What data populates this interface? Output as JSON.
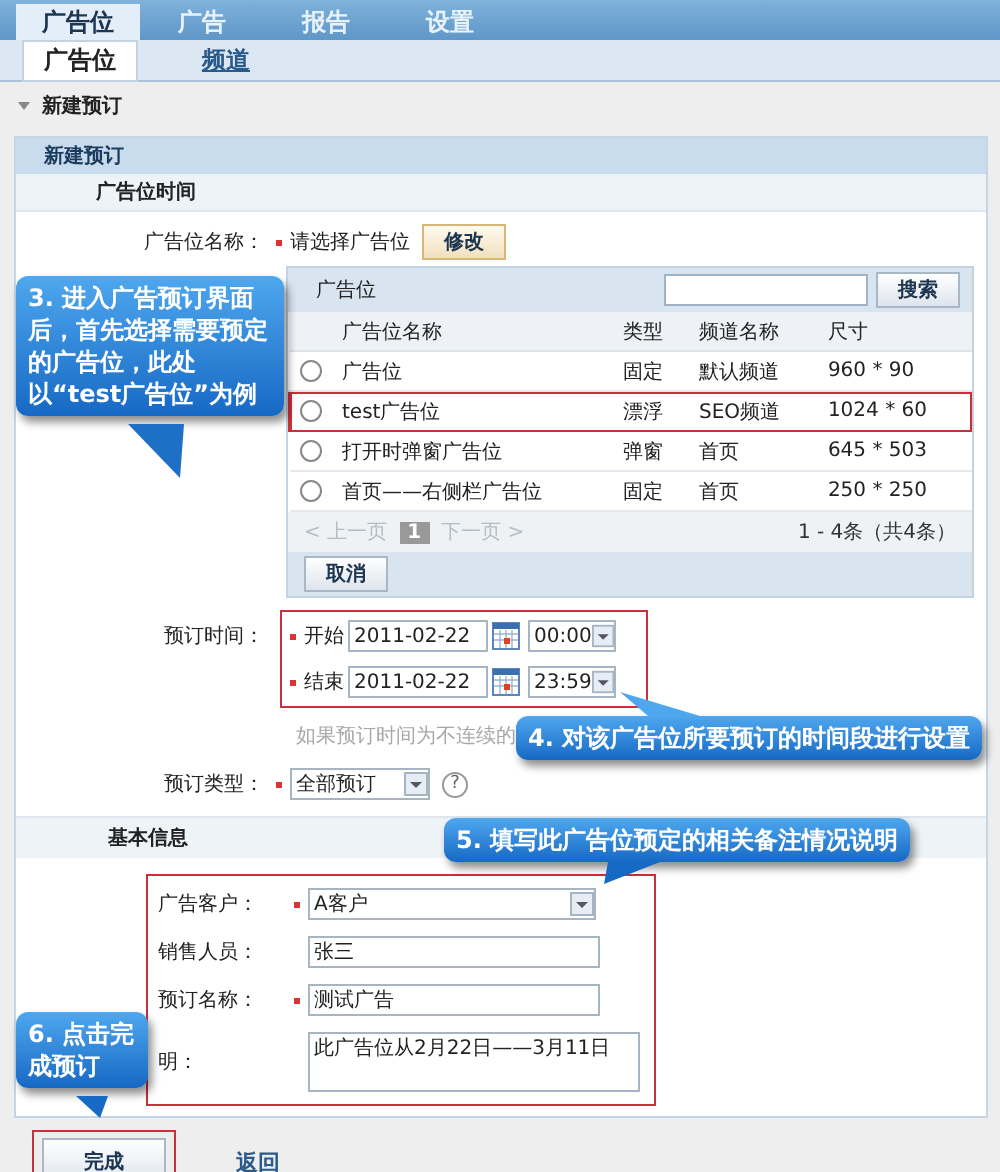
{
  "nav_tabs": [
    {
      "label": "广告位",
      "selected": true
    },
    {
      "label": "广告",
      "selected": false
    },
    {
      "label": "报告",
      "selected": false
    },
    {
      "label": "设置",
      "selected": false
    }
  ],
  "sub_tabs": [
    {
      "label": "广告位",
      "selected": true
    },
    {
      "label": "频道",
      "selected": false
    }
  ],
  "section": {
    "title": "新建预订",
    "expanded": true
  },
  "panel": {
    "title": "新建预订",
    "group_title": "广告位时间"
  },
  "ad_slot": {
    "label": "广告位名称：",
    "required": true,
    "value": "请选择广告位",
    "button": "修改"
  },
  "picker": {
    "title": "广告位",
    "search_button": "搜索",
    "columns": [
      "广告位名称",
      "类型",
      "频道名称",
      "尺寸"
    ],
    "rows": [
      {
        "selected": false,
        "highlighted": false,
        "cells": [
          "广告位",
          "固定",
          "默认频道",
          "960 * 90"
        ]
      },
      {
        "selected": false,
        "highlighted": true,
        "cells": [
          "test广告位",
          "漂浮",
          "SEO频道",
          "1024 * 60"
        ]
      },
      {
        "selected": false,
        "highlighted": false,
        "cells": [
          "打开时弹窗广告位",
          "弹窗",
          "首页",
          "645 * 503"
        ]
      },
      {
        "selected": false,
        "highlighted": false,
        "cells": [
          "首页——右侧栏广告位",
          "固定",
          "首页",
          "250 * 250"
        ]
      }
    ],
    "pager": {
      "prev": "< 上一页",
      "page": "1",
      "next": "下一页 >",
      "summary": "1 - 4条（共4条）"
    },
    "cancel": "取消"
  },
  "booking_time": {
    "label": "预订时间：",
    "rows": [
      {
        "label": "开始",
        "required": true,
        "date": "2011-02-22",
        "time": "00:00"
      },
      {
        "label": "结束",
        "required": true,
        "date": "2011-02-22",
        "time": "23:59"
      }
    ],
    "hint": "如果预订时间为不连续的"
  },
  "booking_type": {
    "label": "预订类型：",
    "required": true,
    "value": "全部预订",
    "help": "?"
  },
  "basic_info": {
    "title": "基本信息",
    "fields": [
      {
        "kind": "select",
        "label": "广告客户：",
        "required": true,
        "value": "A客户"
      },
      {
        "kind": "text",
        "label": "销售人员：",
        "required": false,
        "value": "张三"
      },
      {
        "kind": "text",
        "label": "预订名称：",
        "required": true,
        "value": "测试广告"
      },
      {
        "kind": "textarea",
        "label": "明：",
        "required": false,
        "value": "此广告位从2月22日——3月11日"
      }
    ]
  },
  "actions": {
    "done": "完成",
    "back": "返回"
  },
  "callouts": [
    {
      "text": "3. 进入广告预订界面后，首先选择需要预定的广告位，此处以“test广告位”为例"
    },
    {
      "text": "4. 对该广告位所要预订的时间段进行设置"
    },
    {
      "text": "5. 填写此广告位预定的相关备注情况说明"
    },
    {
      "text": "6. 点击完成预订"
    }
  ]
}
